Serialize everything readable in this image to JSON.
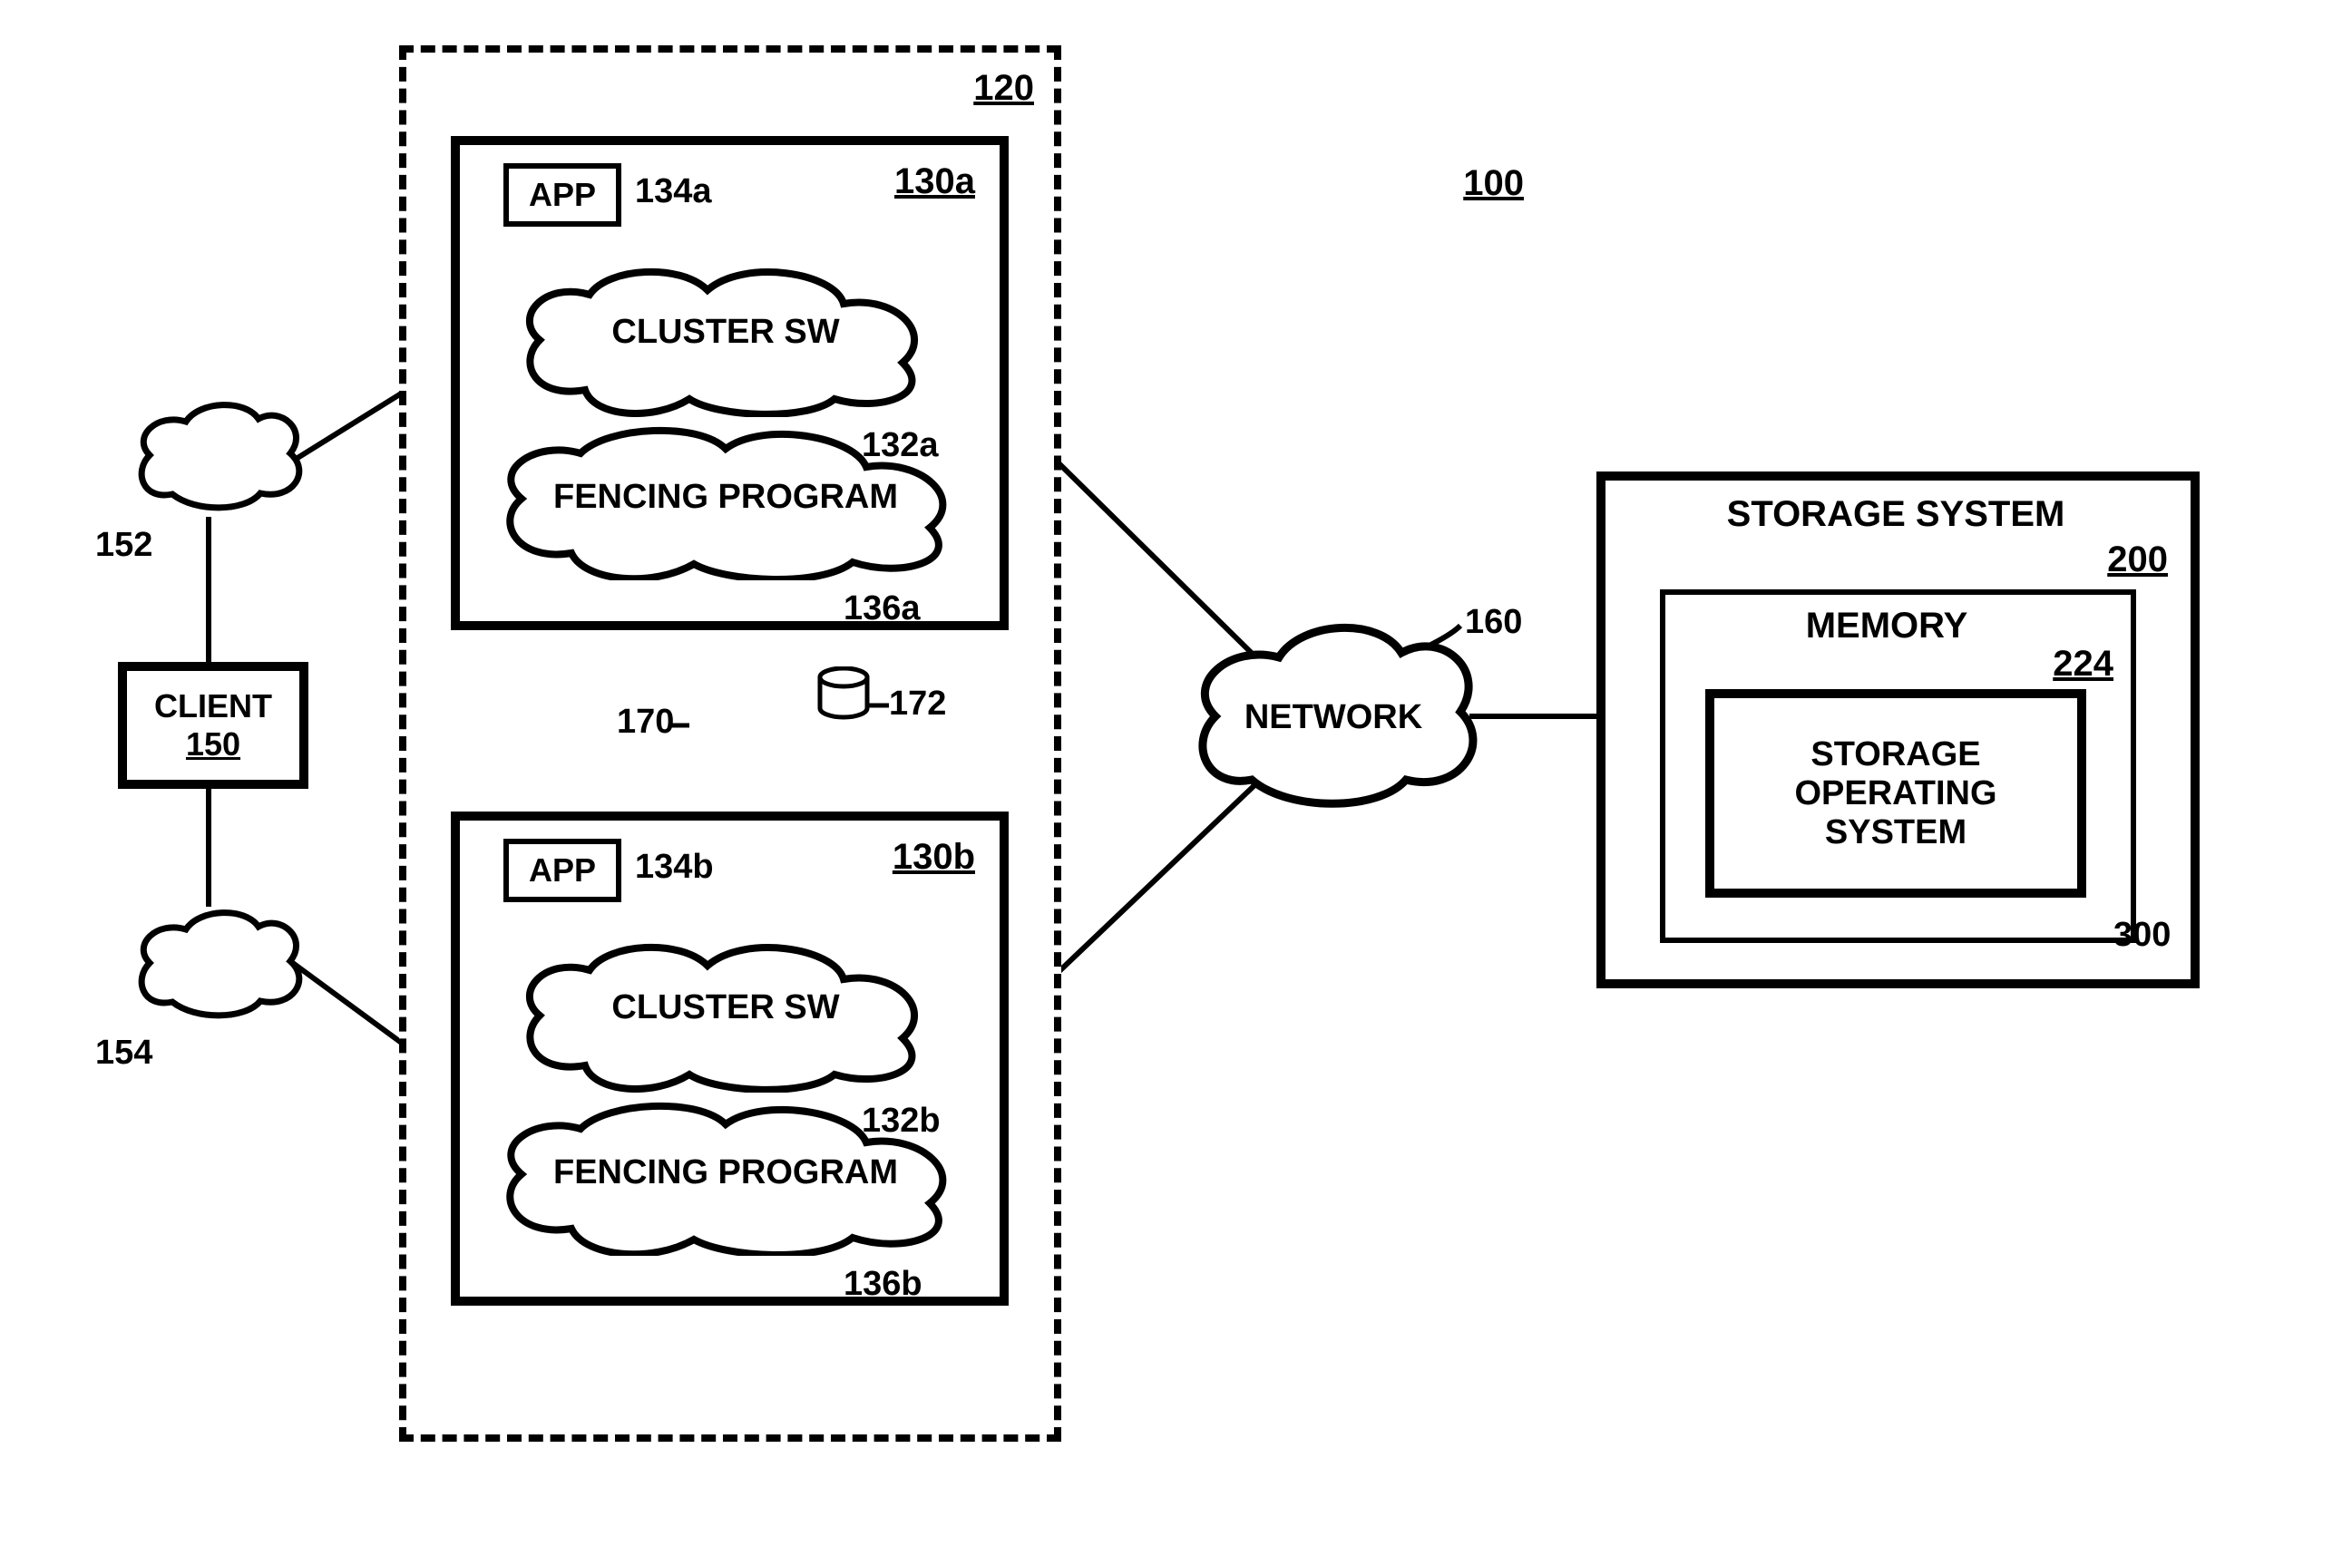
{
  "figure": {
    "overall_ref": "100",
    "cluster_group_ref": "120",
    "interconnect_ref": "170",
    "quorum_ref": "172"
  },
  "client": {
    "label": "CLIENT",
    "ref": "150",
    "top_cloud_ref": "152",
    "bottom_cloud_ref": "154"
  },
  "nodes": [
    {
      "ref": "130a",
      "app_label": "APP",
      "app_ref": "134a",
      "cluster_sw_label": "CLUSTER SW",
      "cluster_sw_ref": "132a",
      "fencing_label": "FENCING PROGRAM",
      "fencing_ref": "136a"
    },
    {
      "ref": "130b",
      "app_label": "APP",
      "app_ref": "134b",
      "cluster_sw_label": "CLUSTER SW",
      "cluster_sw_ref": "132b",
      "fencing_label": "FENCING PROGRAM",
      "fencing_ref": "136b"
    }
  ],
  "network": {
    "label": "NETWORK",
    "ref": "160"
  },
  "storage": {
    "title": "STORAGE SYSTEM",
    "ref": "200",
    "memory_label": "MEMORY",
    "memory_ref": "224",
    "os_label_1": "STORAGE",
    "os_label_2": "OPERATING",
    "os_label_3": "SYSTEM",
    "os_ref": "300"
  }
}
